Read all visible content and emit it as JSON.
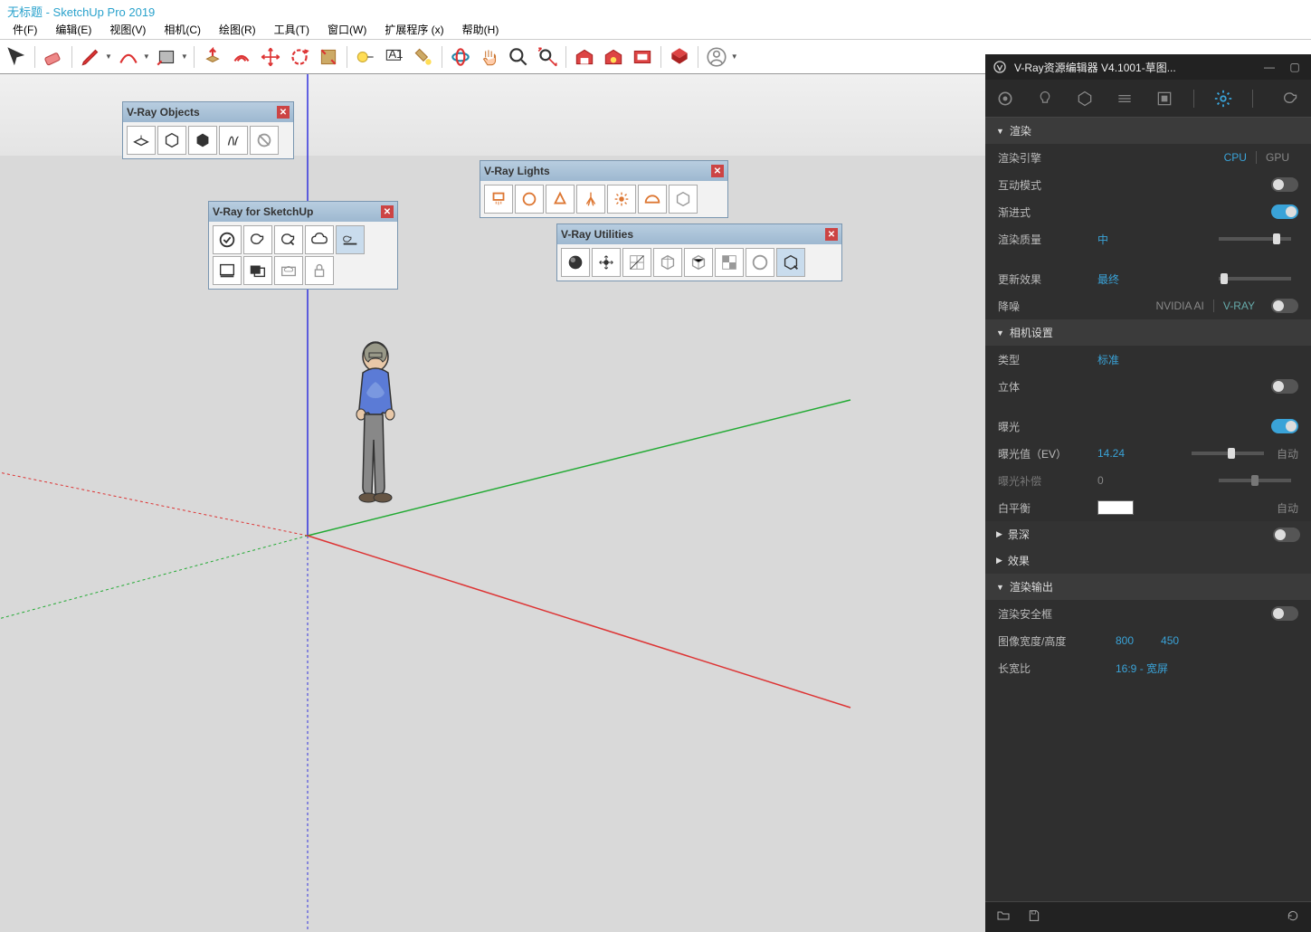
{
  "title": "无标题 - SketchUp Pro 2019",
  "menu": {
    "file": "件(F)",
    "edit": "编辑(E)",
    "view": "视图(V)",
    "camera": "相机(C)",
    "draw": "绘图(R)",
    "tools": "工具(T)",
    "window": "窗口(W)",
    "ext": "扩展程序 (x)",
    "help": "帮助(H)"
  },
  "panels": {
    "objects": {
      "title": "V-Ray Objects"
    },
    "sketchup": {
      "title": "V-Ray for SketchUp"
    },
    "lights": {
      "title": "V-Ray Lights"
    },
    "utilities": {
      "title": "V-Ray Utilities"
    }
  },
  "vray": {
    "title": "V-Ray资源编辑器 V4.1001-草图...",
    "section_render": "渲染",
    "engine_label": "渲染引擎",
    "engine_cpu": "CPU",
    "engine_gpu": "GPU",
    "interactive": "互动模式",
    "progressive": "渐进式",
    "quality_label": "渲染质量",
    "quality_value": "中",
    "update_label": "更新效果",
    "update_value": "最终",
    "denoise_label": "降噪",
    "denoise_nvidia": "NVIDIA AI",
    "denoise_vray": "V-RAY",
    "section_camera": "相机设置",
    "type_label": "类型",
    "type_value": "标准",
    "stereo": "立体",
    "exposure": "曝光",
    "ev_label": "曝光值（EV）",
    "ev_value": "14.24",
    "ec_label": "曝光补偿",
    "ec_value": "0",
    "wb_label": "白平衡",
    "auto": "自动",
    "dof": "景深",
    "effects": "效果",
    "section_output": "渲染输出",
    "safe_frame": "渲染安全框",
    "wh_label": "图像宽度/高度",
    "width": "800",
    "height": "450",
    "aspect_label": "长宽比",
    "aspect_value": "16:9 - 宽屏"
  }
}
